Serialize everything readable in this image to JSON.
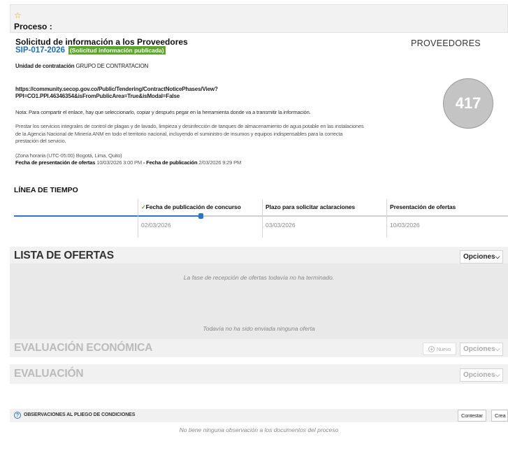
{
  "proceso": {
    "label": "Proceso :",
    "title": "Solicitud de información a los Proveedores",
    "code": "SIP-017-2026",
    "status_badge": "(Solicitud información publicada)",
    "unidad_label": "Unidad de contratación",
    "unidad_value": "GRUPO DE CONTRATACION",
    "link_line1": "https://community.secop.gov.co/Public/Tendering/ContractNoticePhases/View?",
    "link_line2": "PPI=CO1.PPI.46346354&isFromPublicArea=True&isModal=False",
    "nota": "Nota: Para compartir el enlace, hay que seleccionarlo, copiar y después pegar en la herramienta donde va a transmitir la información.",
    "description": "Prestar los servicios integrales de control de plagas y de lavado, limpieza y desinfección de tanques de almacenamiento de agua potable en las instalaciones de la Agencia Nacional de Minería ANM en todo el territorio nacional, incluyendo el suministro de insumos y equipos indispensables para la correcta prestación del servicio.",
    "zona": "(Zona horaria (UTC-05:00) Bogotá, Lima, Quito)",
    "fecha_presentacion_label": "Fecha de presentación de ofertas",
    "fecha_presentacion_value": "10/03/2026 3:00 PM",
    "separator": " - ",
    "fecha_publicacion_label": "Fecha de publicación",
    "fecha_publicacion_value": "2/03/2026 9:29 PM",
    "colors": {
      "code": "#1a6fc8",
      "badge_bg": "#5aa72a"
    }
  },
  "proveedores": {
    "title": "PROVEEDORES",
    "count": "417"
  },
  "timeline": {
    "title": "LÍNEA DE TIEMPO",
    "check": "✓",
    "columns": [
      {
        "label": "Fecha de publicación de concurso",
        "date": "02/03/2026"
      },
      {
        "label": "Plazo para solicitar aclaraciones",
        "date": "03/03/2026"
      },
      {
        "label": "Presentación de ofertas",
        "date": "10/03/2026"
      }
    ]
  },
  "lista_ofertas": {
    "title": "LISTA DE OFERTAS",
    "options_label": "Opciones",
    "msg_fase": "La fase de recepción de ofertas todavía no ha terminado.",
    "msg_ninguna": "Todavía no ha sido enviada ninguna oferta"
  },
  "evaluacion_economica": {
    "title": "EVALUACIÓN ECONÓMICA",
    "nuevo_label": "Nuevo",
    "options_label": "Opciones"
  },
  "evaluacion": {
    "title": "EVALUACIÓN",
    "options_label": "Opciones"
  },
  "observaciones": {
    "title": "OBSERVACIONES AL PLIEGO DE CONDICIONES",
    "contestar_label": "Contestar",
    "crear_label": "Crea",
    "empty_msg": "No tiene ninguna observación a los documentos del proceso"
  },
  "icons": {
    "star": "☆",
    "caret": "⌵",
    "plus": "+",
    "question": "?"
  }
}
